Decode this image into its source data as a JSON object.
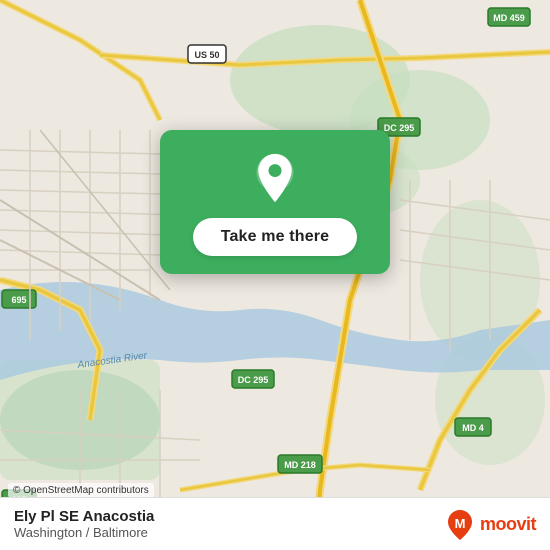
{
  "map": {
    "attribution": "© OpenStreetMap contributors"
  },
  "card": {
    "button_label": "Take me there"
  },
  "bottom_bar": {
    "location_name": "Ely Pl SE Anacostia",
    "location_region": "Washington / Baltimore",
    "moovit_label": "moovit"
  }
}
